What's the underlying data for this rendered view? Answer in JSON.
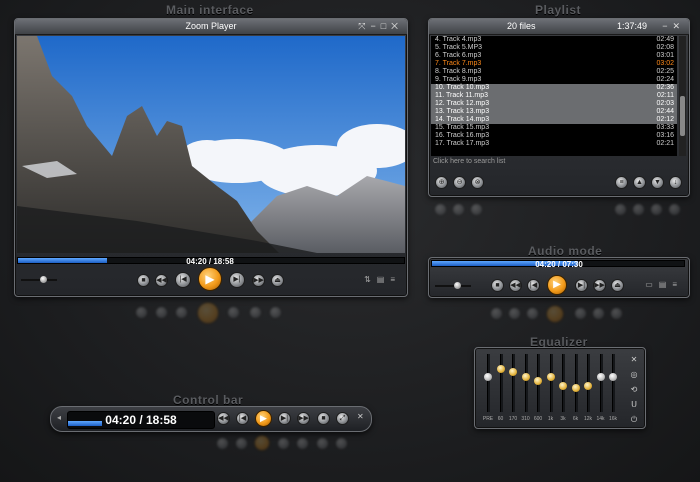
{
  "titles": {
    "main": "Main interface",
    "playlist": "Playlist",
    "audio": "Audio mode",
    "equalizer": "Equalizer",
    "controlbar": "Control bar"
  },
  "main": {
    "window_title": "Zoom Player",
    "time": "04:20 / 18:58",
    "progress": 0.23,
    "volume": 0.6
  },
  "playlist": {
    "file_count": "20 files",
    "total_time": "1:37:49",
    "search_placeholder": "Click here to search list",
    "tracks": [
      {
        "name": "4. Track 4.mp3",
        "dur": "02:49",
        "state": "normal"
      },
      {
        "name": "5. Track 5.MP3",
        "dur": "02:08",
        "state": "normal"
      },
      {
        "name": "6. Track 6.mp3",
        "dur": "03:01",
        "state": "normal"
      },
      {
        "name": "7. Track 7.mp3",
        "dur": "03:02",
        "state": "playing"
      },
      {
        "name": "8. Track 8.mp3",
        "dur": "02:25",
        "state": "normal"
      },
      {
        "name": "9. Track 9.mp3",
        "dur": "02:24",
        "state": "normal"
      },
      {
        "name": "10. Track 10.mp3",
        "dur": "02:36",
        "state": "selected"
      },
      {
        "name": "11. Track 11.mp3",
        "dur": "02:11",
        "state": "selected"
      },
      {
        "name": "12. Track 12.mp3",
        "dur": "02:03",
        "state": "selected"
      },
      {
        "name": "13. Track 13.mp3",
        "dur": "02:44",
        "state": "selected"
      },
      {
        "name": "14. Track 14.mp3",
        "dur": "02:12",
        "state": "selected"
      },
      {
        "name": "15. Track 15.mp3",
        "dur": "03:33",
        "state": "normal"
      },
      {
        "name": "16. Track 16.mp3",
        "dur": "03:16",
        "state": "normal"
      },
      {
        "name": "17. Track 17.mp3",
        "dur": "02:21",
        "state": "normal"
      }
    ]
  },
  "audio": {
    "time": "04:20 / 07:30",
    "progress": 0.58,
    "volume": 0.6
  },
  "equalizer": {
    "bands": [
      {
        "label": "PRE",
        "level": 0.62,
        "accent": false
      },
      {
        "label": "60",
        "level": 0.78,
        "accent": true
      },
      {
        "label": "170",
        "level": 0.72,
        "accent": true
      },
      {
        "label": "310",
        "level": 0.62,
        "accent": true
      },
      {
        "label": "600",
        "level": 0.55,
        "accent": true
      },
      {
        "label": "1k",
        "level": 0.62,
        "accent": true
      },
      {
        "label": "3k",
        "level": 0.45,
        "accent": true
      },
      {
        "label": "6k",
        "level": 0.4,
        "accent": true
      },
      {
        "label": "12k",
        "level": 0.45,
        "accent": true
      },
      {
        "label": "14k",
        "level": 0.62,
        "accent": false
      },
      {
        "label": "16k",
        "level": 0.62,
        "accent": false
      }
    ]
  },
  "controlbar": {
    "time": "04:20 / 18:58",
    "progress": 0.23
  },
  "colors": {
    "accent": "#f29a1a",
    "progress": "#2f7be6",
    "playing_track": "#ff8a1a"
  }
}
